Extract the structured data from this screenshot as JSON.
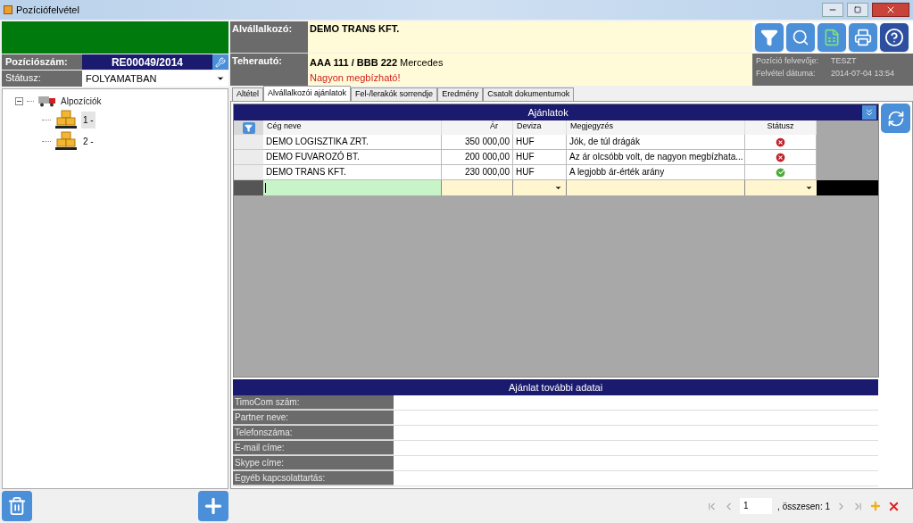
{
  "window": {
    "title": "Pozíciófelvétel"
  },
  "position": {
    "number_label": "Pozíciószám:",
    "number_value": "RE00049/2014",
    "status_label": "Státusz:",
    "status_value": "FOLYAMATBAN"
  },
  "header": {
    "subcontractor_label": "Alvállalkozó:",
    "subcontractor_value": "DEMO TRANS KFT.",
    "truck_label": "Teherautó:",
    "truck_value": "**AAA 111 / BBB 222** Mercedes",
    "truck_note": "Nagyon megbízható!"
  },
  "info": {
    "recorder_label": "Pozíció felvevője:",
    "recorder_value": "TESZT",
    "date_label": "Felvétel dátuma:",
    "date_value": "2014-07-04 13:54"
  },
  "tree": {
    "label": "Alpozíciók",
    "expanded": true,
    "children": [
      {
        "label": "1 -",
        "selected": true
      },
      {
        "label": "2 -",
        "selected": false
      }
    ]
  },
  "tabs": [
    {
      "label": "Altétel",
      "selected": false
    },
    {
      "label": "Alvállalkozói ajánlatok",
      "selected": true
    },
    {
      "label": "Fel-/lerakók sorrendje",
      "selected": false
    },
    {
      "label": "Eredmény",
      "selected": false
    },
    {
      "label": "Csatolt dokumentumok",
      "selected": false
    }
  ],
  "offers": {
    "title": "Ajánlatok",
    "columns": [
      "Cég neve",
      "Ár",
      "Deviza",
      "Megjegyzés",
      "Státusz"
    ],
    "rows": [
      {
        "company": "DEMO LOGISZTIKA ZRT.",
        "price": "350 000,00",
        "currency": "HUF",
        "note": "Jók, de túl drágák",
        "accepted": false
      },
      {
        "company": "DEMO FUVAROZÓ BT.",
        "price": "200 000,00",
        "currency": "HUF",
        "note": "Az ár olcsóbb volt, de nagyon megbízhata...",
        "accepted": false
      },
      {
        "company": "DEMO TRANS KFT.",
        "price": "230 000,00",
        "currency": "HUF",
        "note": "A legjobb ár-érték arány",
        "accepted": true
      }
    ]
  },
  "details": {
    "title": "Ajánlat további adatai",
    "fields": [
      "TimoCom szám:",
      "Partner neve:",
      "Telefonszáma:",
      "E-mail címe:",
      "Skype címe:",
      "Egyéb kapcsolattartás:"
    ]
  },
  "pager": {
    "page": "1",
    "total": ", összesen: 1"
  }
}
